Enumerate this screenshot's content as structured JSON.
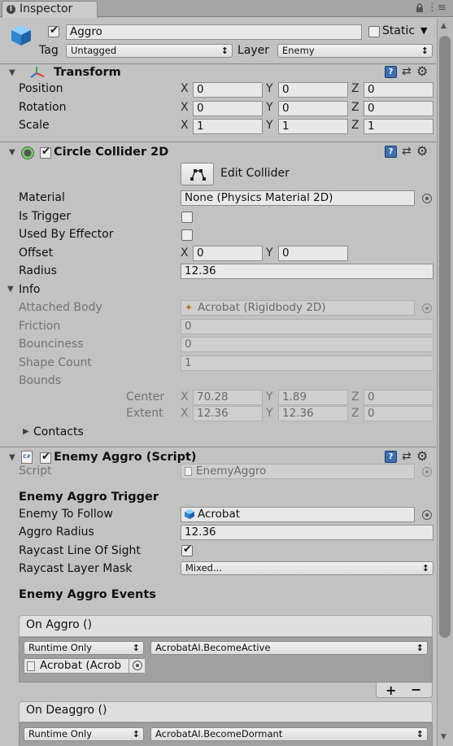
{
  "tab": {
    "title": "Inspector",
    "lock_icon": "lock-icon",
    "menu_icon": "menu-icon"
  },
  "object": {
    "name": "Aggro",
    "static_label": "Static",
    "tag_label": "Tag",
    "tag_value": "Untagged",
    "layer_label": "Layer",
    "layer_value": "Enemy",
    "active": true
  },
  "transform": {
    "title": "Transform",
    "rows": [
      {
        "label": "Position",
        "x": "0",
        "y": "0",
        "z": "0"
      },
      {
        "label": "Rotation",
        "x": "0",
        "y": "0",
        "z": "0"
      },
      {
        "label": "Scale",
        "x": "1",
        "y": "1",
        "z": "1"
      }
    ]
  },
  "axes": {
    "x": "X",
    "y": "Y",
    "z": "Z"
  },
  "collider": {
    "title": "Circle Collider 2D",
    "edit_label": "Edit Collider",
    "material_label": "Material",
    "material_value": "None (Physics Material 2D)",
    "is_trigger_label": "Is Trigger",
    "used_by_effector_label": "Used By Effector",
    "offset_label": "Offset",
    "offset_x": "0",
    "offset_y": "0",
    "radius_label": "Radius",
    "radius_value": "12.36",
    "info_label": "Info",
    "attached_body_label": "Attached Body",
    "attached_body_value": "Acrobat (Rigidbody 2D)",
    "friction_label": "Friction",
    "friction_value": "0",
    "bounciness_label": "Bounciness",
    "bounciness_value": "0",
    "shape_count_label": "Shape Count",
    "shape_count_value": "1",
    "bounds_label": "Bounds",
    "center_label": "Center",
    "center_x": "70.28",
    "center_y": "1.89",
    "center_z": "0",
    "extent_label": "Extent",
    "extent_x": "12.36",
    "extent_y": "12.36",
    "extent_z": "0",
    "contacts_label": "Contacts"
  },
  "script": {
    "title": "Enemy Aggro (Script)",
    "script_label": "Script",
    "script_value": "EnemyAggro",
    "trigger_header": "Enemy Aggro Trigger",
    "follow_label": "Enemy To Follow",
    "follow_value": "Acrobat",
    "radius_label": "Aggro Radius",
    "radius_value": "12.36",
    "los_label": "Raycast Line Of Sight",
    "mask_label": "Raycast Layer Mask",
    "mask_value": "Mixed...",
    "events_header": "Enemy Aggro Events",
    "on_aggro": {
      "title": "On Aggro ()",
      "mode": "Runtime Only",
      "function": "AcrobatAI.BecomeActive",
      "target": "Acrobat (Acrob"
    },
    "add": "+",
    "remove": "−",
    "on_deaggro": {
      "title": "On Deaggro ()",
      "mode": "Runtime Only",
      "function": "AcrobatAI.BecomeDormant"
    }
  }
}
